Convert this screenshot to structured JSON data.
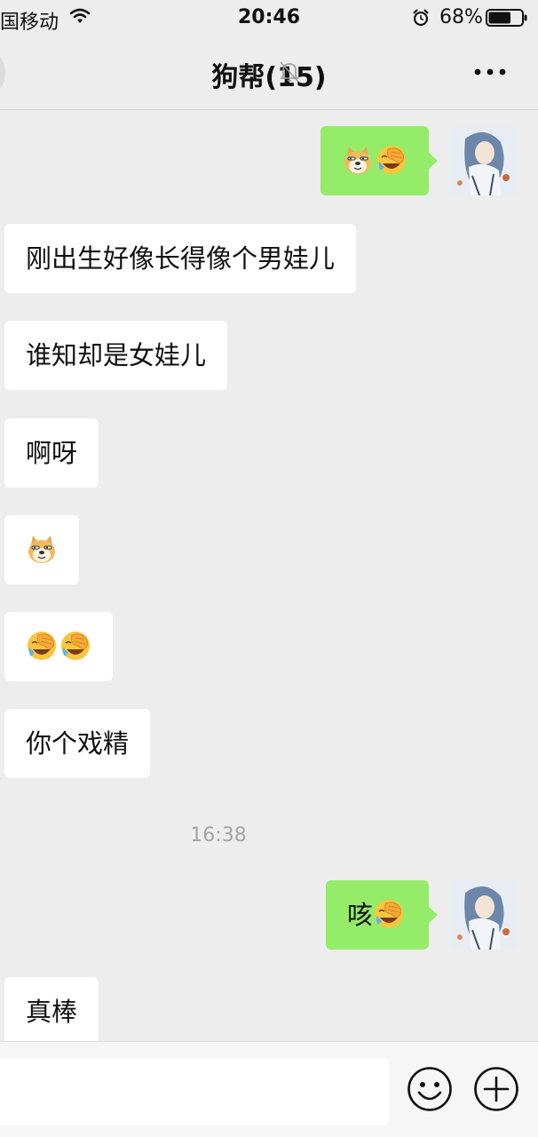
{
  "status_bar": {
    "carrier": "国移动",
    "time": "20:46",
    "battery_percent": "68%",
    "battery_level": 0.68
  },
  "nav": {
    "title": "狗帮(15)",
    "muted": true
  },
  "messages": [
    {
      "direction": "out",
      "text": "",
      "emojis": [
        "doge-emoji",
        "facepalm-laugh-emoji"
      ]
    },
    {
      "direction": "in",
      "text": "刚出生好像长得像个男娃儿",
      "emojis": []
    },
    {
      "direction": "in",
      "text": "谁知却是女娃儿",
      "emojis": []
    },
    {
      "direction": "in",
      "text": "啊呀",
      "emojis": []
    },
    {
      "direction": "in",
      "text": "",
      "emojis": [
        "doge-emoji"
      ]
    },
    {
      "direction": "in",
      "text": "",
      "emojis": [
        "facepalm-laugh-emoji",
        "facepalm-laugh-emoji"
      ]
    },
    {
      "direction": "in",
      "text": "你个戏精",
      "emojis": []
    },
    {
      "direction": "out",
      "text": "咳",
      "emojis": [
        "facepalm-laugh-emoji"
      ]
    },
    {
      "direction": "in",
      "text": "真棒",
      "emojis": []
    }
  ],
  "timestamp": "16:38",
  "input": {
    "value": "",
    "placeholder": ""
  },
  "colors": {
    "background": "#ededed",
    "outgoing_bubble": "#95ec69",
    "incoming_bubble": "#ffffff",
    "timestamp_text": "#a5a5a5"
  }
}
